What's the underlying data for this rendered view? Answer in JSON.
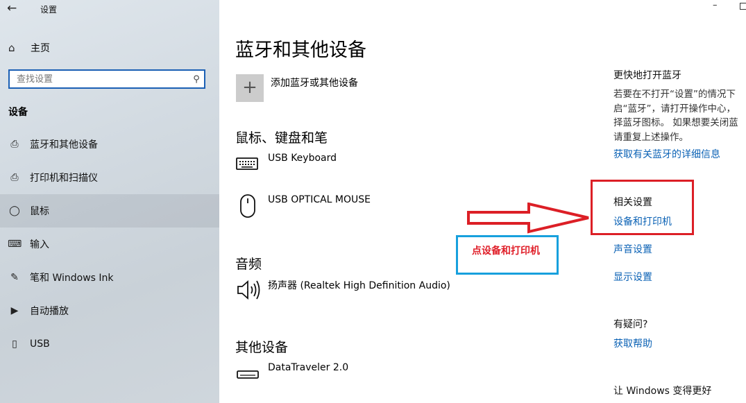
{
  "app_title": "设置",
  "sidebar": {
    "home_label": "主页",
    "search_placeholder": "查找设置",
    "section_title": "设备",
    "items": [
      {
        "label": "蓝牙和其他设备",
        "icon": "bluetooth-devices-icon"
      },
      {
        "label": "打印机和扫描仪",
        "icon": "printer-icon"
      },
      {
        "label": "鼠标",
        "icon": "mouse-icon",
        "active": true
      },
      {
        "label": "输入",
        "icon": "keyboard-icon"
      },
      {
        "label": "笔和 Windows Ink",
        "icon": "pen-icon"
      },
      {
        "label": "自动播放",
        "icon": "autoplay-icon"
      },
      {
        "label": "USB",
        "icon": "usb-icon"
      }
    ]
  },
  "main": {
    "title": "蓝牙和其他设备",
    "add_label": "添加蓝牙或其他设备",
    "categories": [
      {
        "title": "鼠标、键盘和笔",
        "devices": [
          {
            "name": "USB Keyboard",
            "icon": "keyboard-icon"
          },
          {
            "name": "USB OPTICAL MOUSE",
            "icon": "mouse-icon"
          }
        ]
      },
      {
        "title": "音频",
        "devices": [
          {
            "name": "扬声器 (Realtek High Definition Audio)",
            "icon": "speaker-icon"
          }
        ]
      },
      {
        "title": "其他设备",
        "devices": [
          {
            "name": "DataTraveler 2.0",
            "icon": "usb-drive-icon"
          }
        ]
      }
    ]
  },
  "right": {
    "quick_title": "更快地打开蓝牙",
    "quick_desc": [
      "若要在不打开“设置”的情况下",
      "启“蓝牙”，请打开操作中心，",
      "择蓝牙图标。 如果想要关闭蓝",
      "请重复上述操作。"
    ],
    "bt_link": "获取有关蓝牙的详细信息",
    "related_title": "相关设置",
    "devices_printers_link": "设备和打印机",
    "sound_link": "声音设置",
    "display_link": "显示设置",
    "question_title": "有疑问?",
    "help_link": "获取帮助",
    "better_title": "让 Windows 变得更好"
  },
  "annotation": {
    "label": "点设备和打印机",
    "arrow_color": "#dc1f26",
    "box_color": "#dc1f26",
    "label_box_color": "#17a0dd"
  },
  "colors": {
    "link": "#0b62b5",
    "accent": "#1a5fb4"
  }
}
